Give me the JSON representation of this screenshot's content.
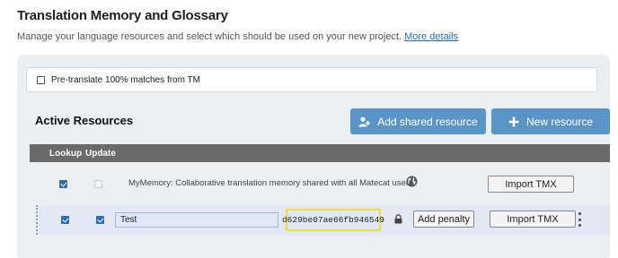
{
  "header": {
    "title": "Translation Memory and Glossary",
    "subtitle": "Manage your language resources and select which should be used on your new project.",
    "more_details_link": "More details"
  },
  "pretranslate": {
    "label": "Pre-translate 100% matches from TM",
    "checked": false
  },
  "active_resources": {
    "title": "Active Resources",
    "add_shared_label": "Add shared resource",
    "new_resource_label": "New resource",
    "columns": {
      "lookup": "Lookup",
      "update": "Update"
    },
    "rows": [
      {
        "lookup": true,
        "update": false,
        "name": "MyMemory: Collaborative translation memory shared with all Matecat users.",
        "import_label": "Import TMX",
        "icon": "globe-icon"
      },
      {
        "lookup": true,
        "update": true,
        "name": "Test",
        "key": "d629be07ae66fb946549",
        "penalty_label": "Add penalty",
        "import_label": "Import TMX",
        "icon": "lock-icon"
      }
    ]
  },
  "colors": {
    "accent": "#5b95c8",
    "header_bar": "#6a6a6a",
    "highlight": "#f5db3b"
  }
}
